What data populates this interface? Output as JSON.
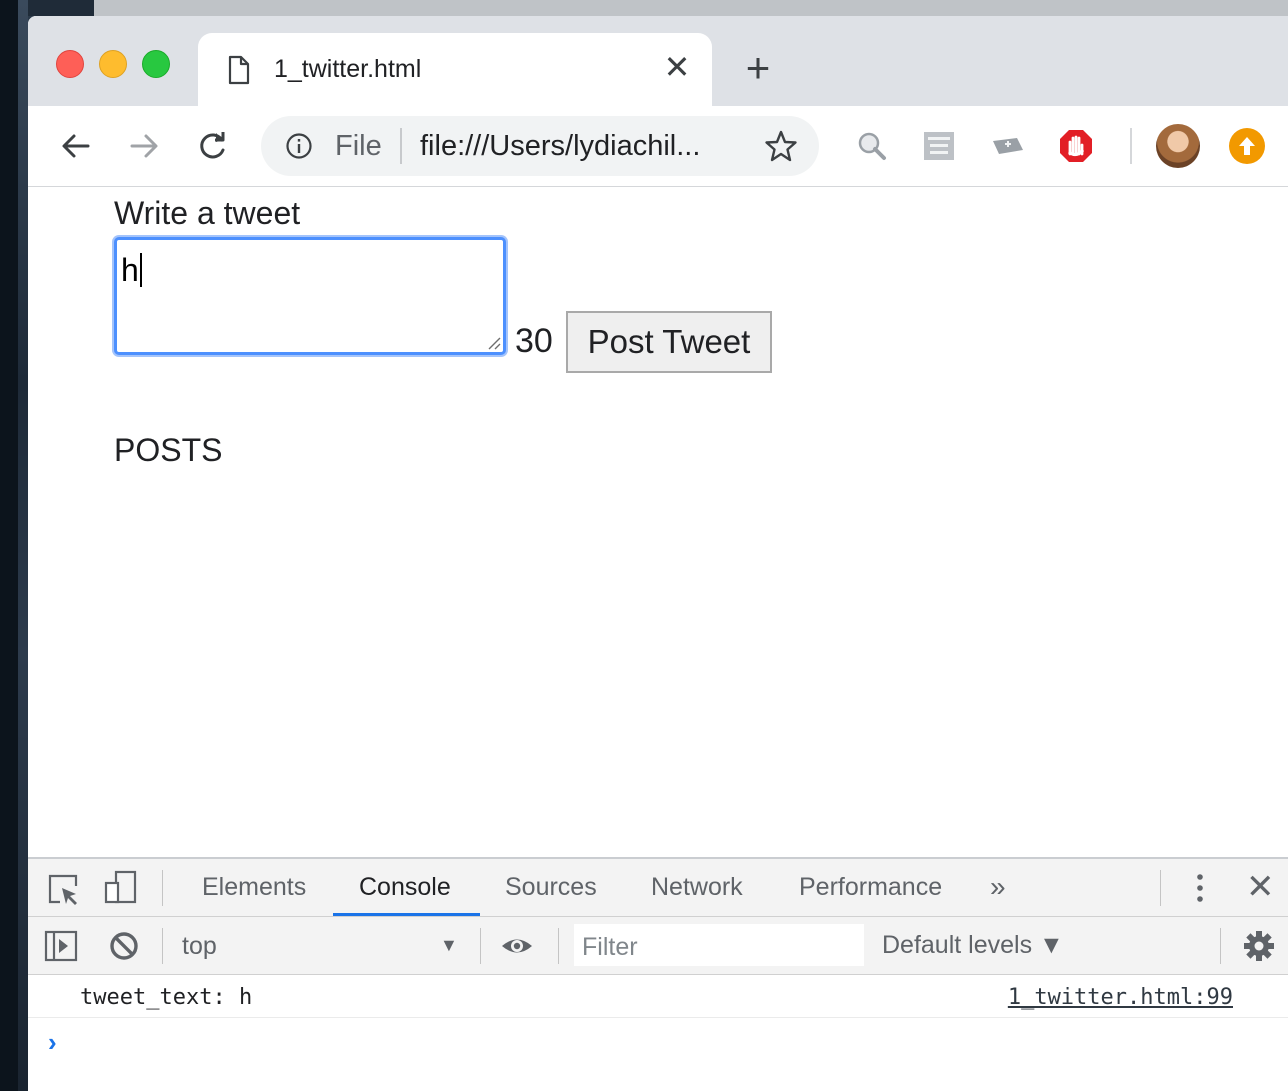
{
  "browser": {
    "tab_title": "1_twitter.html",
    "close_tab_glyph": "✕",
    "new_tab_glyph": "+",
    "omnibox": {
      "security_label": "File",
      "url": "file:///Users/lydiachil..."
    },
    "colors": {
      "titlebar": "#dee1e6",
      "accent": "#1a73e8"
    }
  },
  "page": {
    "heading": "Write a tweet",
    "tweet_input_value": "h",
    "char_counter": "30",
    "post_button_label": "Post Tweet",
    "posts_heading": "POSTS"
  },
  "devtools": {
    "tabs": [
      "Elements",
      "Console",
      "Sources",
      "Network",
      "Performance"
    ],
    "active_tab": "Console",
    "more_tabs_glyph": "»",
    "close_glyph": "✕",
    "context": "top",
    "filter_placeholder": "Filter",
    "levels_label": "Default levels ▼",
    "console_log": {
      "message": "tweet_text: h",
      "source": "1_twitter.html:99"
    },
    "prompt_glyph": "›"
  }
}
